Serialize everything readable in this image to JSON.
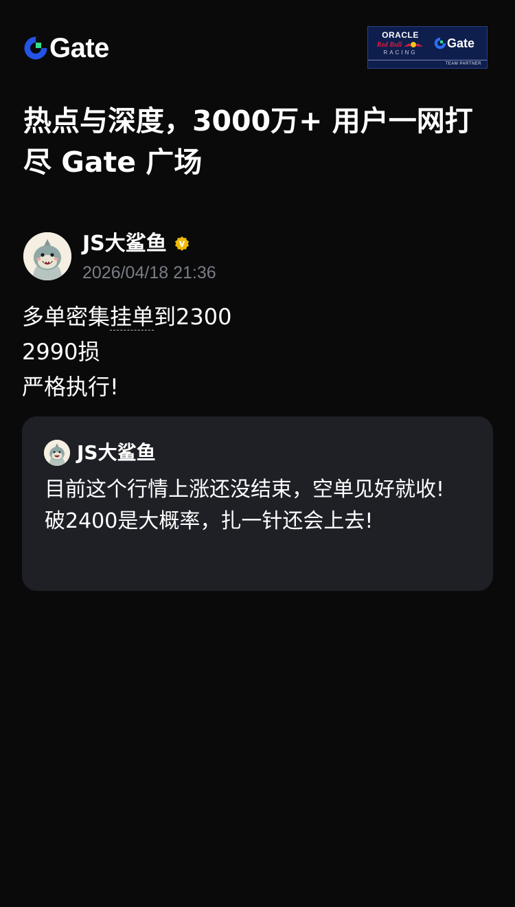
{
  "app": {
    "logo_text": "Gate",
    "logo_icon": "gate-logo-icon",
    "accent_color": "#2354e6"
  },
  "partner_badge": {
    "oracle": "ORACLE",
    "redbull": "Red Bull",
    "racing": "RACING",
    "gate": "Gate",
    "team_partner": "TEAM PARTNER"
  },
  "headline": "热点与深度，3000万+ 用户一网打尽 Gate 广场",
  "author": {
    "name": "JS大鲨鱼",
    "verified_icon": "verified-badge-icon",
    "verified_color": "#f0b90b",
    "timestamp": "2026/04/18 21:36",
    "avatar_icon": "shark-avatar"
  },
  "post": {
    "line1_a": "多单密集",
    "line1_link": "挂单",
    "line1_b": "到2300",
    "line2": "2990损",
    "line3": "严格执行!"
  },
  "quote": {
    "author_name": "JS大鲨鱼",
    "lines": [
      "目前这个行情上涨还没结束，空单见好就收!",
      "破2400是大概率，扎一针还会上去!"
    ]
  }
}
